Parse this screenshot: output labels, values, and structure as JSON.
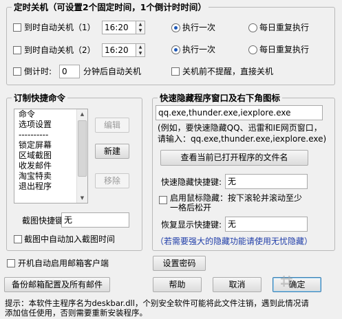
{
  "timed_shutdown": {
    "title": "定时关机（可设置2个固定时间，1个倒计时时间）",
    "row1": {
      "label": "到时自动关机（1）",
      "time": "16:20",
      "once_label": "执行一次",
      "daily_label": "每日重复执行"
    },
    "row2": {
      "label": "到时自动关机（2）",
      "time": "16:20",
      "once_label": "执行一次",
      "daily_label": "每日重复执行"
    },
    "countdown": {
      "label": "倒计时:",
      "value": "0",
      "suffix": "分钟后自动关机"
    },
    "no_prompt_label": "关机前不提醒，直接关机"
  },
  "custom_commands": {
    "title": "订制快捷命令",
    "items": [
      "命令",
      "选项设置",
      "----------",
      "锁定屏幕",
      "区域截图",
      "收发邮件",
      "淘宝特卖",
      "退出程序"
    ],
    "edit_label": "编辑",
    "new_label": "新建",
    "remove_label": "移除",
    "screenshot_hotkey_label": "截图快捷键:",
    "screenshot_hotkey_value": "无",
    "add_time_label": "截图中自动加入截图时间"
  },
  "quick_hide": {
    "title": "快速隐藏程序窗口及右下角图标",
    "processes": "qq.exe,thunder.exe,iexplore.exe",
    "example_line1": "(例如，要快速隐藏QQ、迅雷和IE网页窗口，",
    "example_line2": "请输入：qq.exe,thunder.exe,iexplore.exe)",
    "view_button": "查看当前已打开程序的文件名",
    "hide_hotkey_label": "快速隐藏快捷键:",
    "hide_hotkey_value": "无",
    "mouse_hide_label_1": "启用鼠标隐藏：按下滚轮并滚动至少",
    "mouse_hide_label_2": "一格后松开",
    "restore_hotkey_label": "恢复显示快捷键:",
    "restore_hotkey_value": "无",
    "note": "（若需要强大的隐藏功能请使用无忧隐藏）"
  },
  "bottom": {
    "autostart_label": "开机自动启用邮箱客户端",
    "set_password": "设置密码",
    "backup": "备份邮箱配置及所有邮件",
    "help": "帮助",
    "cancel": "取消",
    "ok": "确定",
    "tip_line1": "提示：本软件主程序名为deskbar.dll，个别安全软件可能将此文件注销，遇到此情况请",
    "tip_line2": "添加信任使用，否则需要重新安装程序。"
  },
  "colors": {
    "accent": "#1d58b8",
    "note_blue": "#1f3da8",
    "background": "#f0f0f0"
  }
}
